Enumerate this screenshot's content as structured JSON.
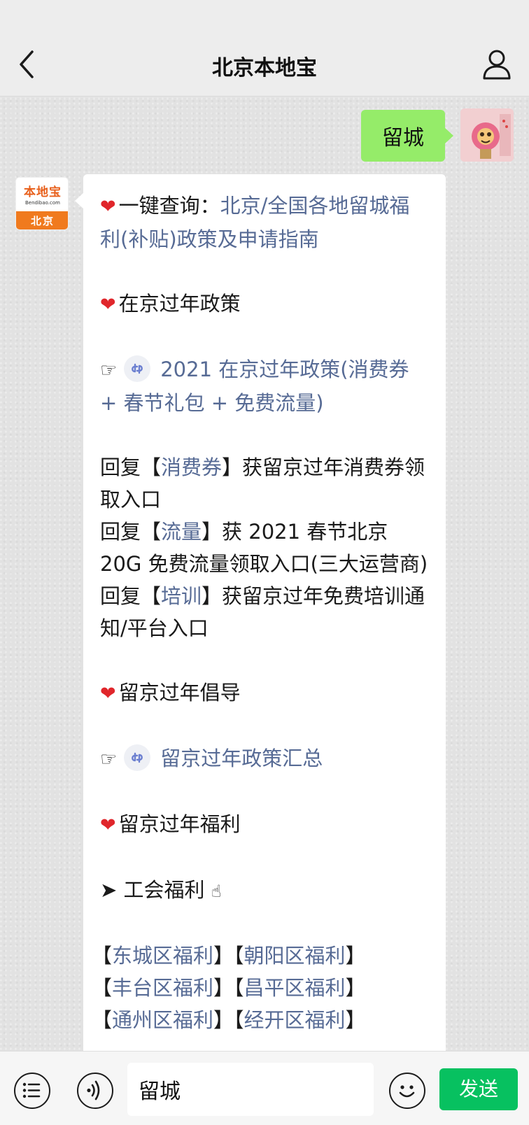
{
  "header": {
    "title": "北京本地宝",
    "back_icon": "chevron-left-icon",
    "profile_icon": "person-icon"
  },
  "outgoing": {
    "text": "留城"
  },
  "official_avatar": {
    "brand": "本地宝",
    "domain": "Bendibao.com",
    "city": "北京"
  },
  "message": {
    "l1_prefix": "一键查询：",
    "l1_link": "北京/全国各地留城福利(补贴)政策及申请指南",
    "l2": "在京过年政策",
    "l3_link": "2021 在京过年政策(消费券 + 春节礼包 + 免费流量)",
    "l4_a": "回复【",
    "l4_link": "消费券",
    "l4_b": "】获留京过年消费券领取入口",
    "l5_a": "回复【",
    "l5_link": "流量",
    "l5_b": "】获 2021 春节北京 20G 免费流量领取入口(三大运营商)",
    "l6_a": "回复【",
    "l6_link": "培训",
    "l6_b": "】获留京过年免费培训通知/平台入口",
    "l7": "留京过年倡导",
    "l8_link": "留京过年政策汇总",
    "l9": "留京过年福利",
    "l10": "➤ 工会福利",
    "districts": [
      [
        "东城区福利",
        "朝阳区福利"
      ],
      [
        "丰台区福利",
        "昌平区福利"
      ],
      [
        "通州区福利",
        "经开区福利"
      ]
    ]
  },
  "input": {
    "value": "留城",
    "send_label": "发送"
  },
  "colors": {
    "link": "#576b95",
    "outgoing_bubble": "#95ec69",
    "send_button": "#07c160",
    "heart": "#e0262b"
  }
}
